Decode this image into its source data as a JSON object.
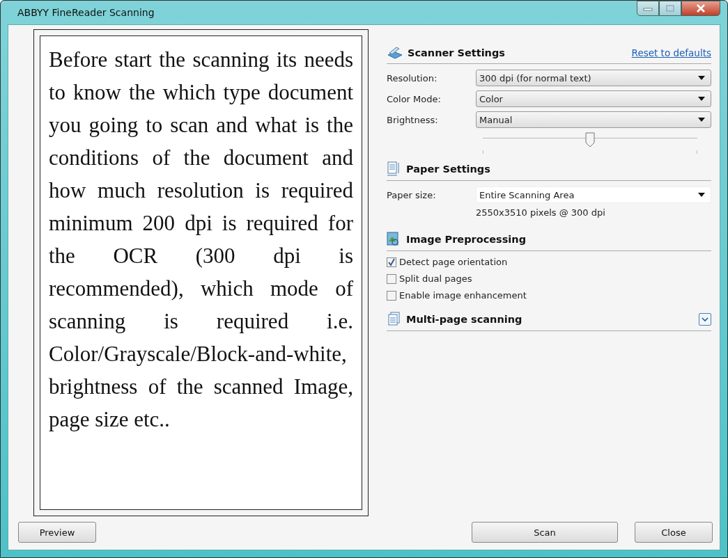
{
  "window": {
    "title": "ABBYY FineReader Scanning"
  },
  "description": "Before start the scanning its needs to know the which type document you going to scan and what is the conditions of the document and how much resolution is required minimum 200 dpi is required for the OCR (300 dpi is recommended), which mode of scanning is required i.e. Color/Grayscale/Block-and-white, brightness of the scanned Image, page size etc..",
  "scanner_settings": {
    "title": "Scanner Settings",
    "reset_link": "Reset to defaults",
    "fields": [
      {
        "label": "Resolution:",
        "value": "300  dpi (for normal text)"
      },
      {
        "label": "Color Mode:",
        "value": "Color"
      },
      {
        "label": "Brightness:",
        "value": "Manual"
      }
    ],
    "brightness_slider": {
      "level": 0.5
    }
  },
  "paper_settings": {
    "title": "Paper Settings",
    "label": "Paper size:",
    "value": "Entire Scanning Area",
    "info": "2550x3510 pixels @ 300 dpi"
  },
  "image_preprocessing": {
    "title": "Image Preprocessing",
    "options": [
      {
        "label": "Detect page orientation",
        "checked": true
      },
      {
        "label": "Split dual pages",
        "checked": false
      },
      {
        "label": "Enable image enhancement",
        "checked": false
      }
    ]
  },
  "multi_page": {
    "title": "Multi-page scanning",
    "expanded": false
  },
  "buttons": {
    "preview": "Preview",
    "scan": "Scan",
    "close": "Close"
  }
}
